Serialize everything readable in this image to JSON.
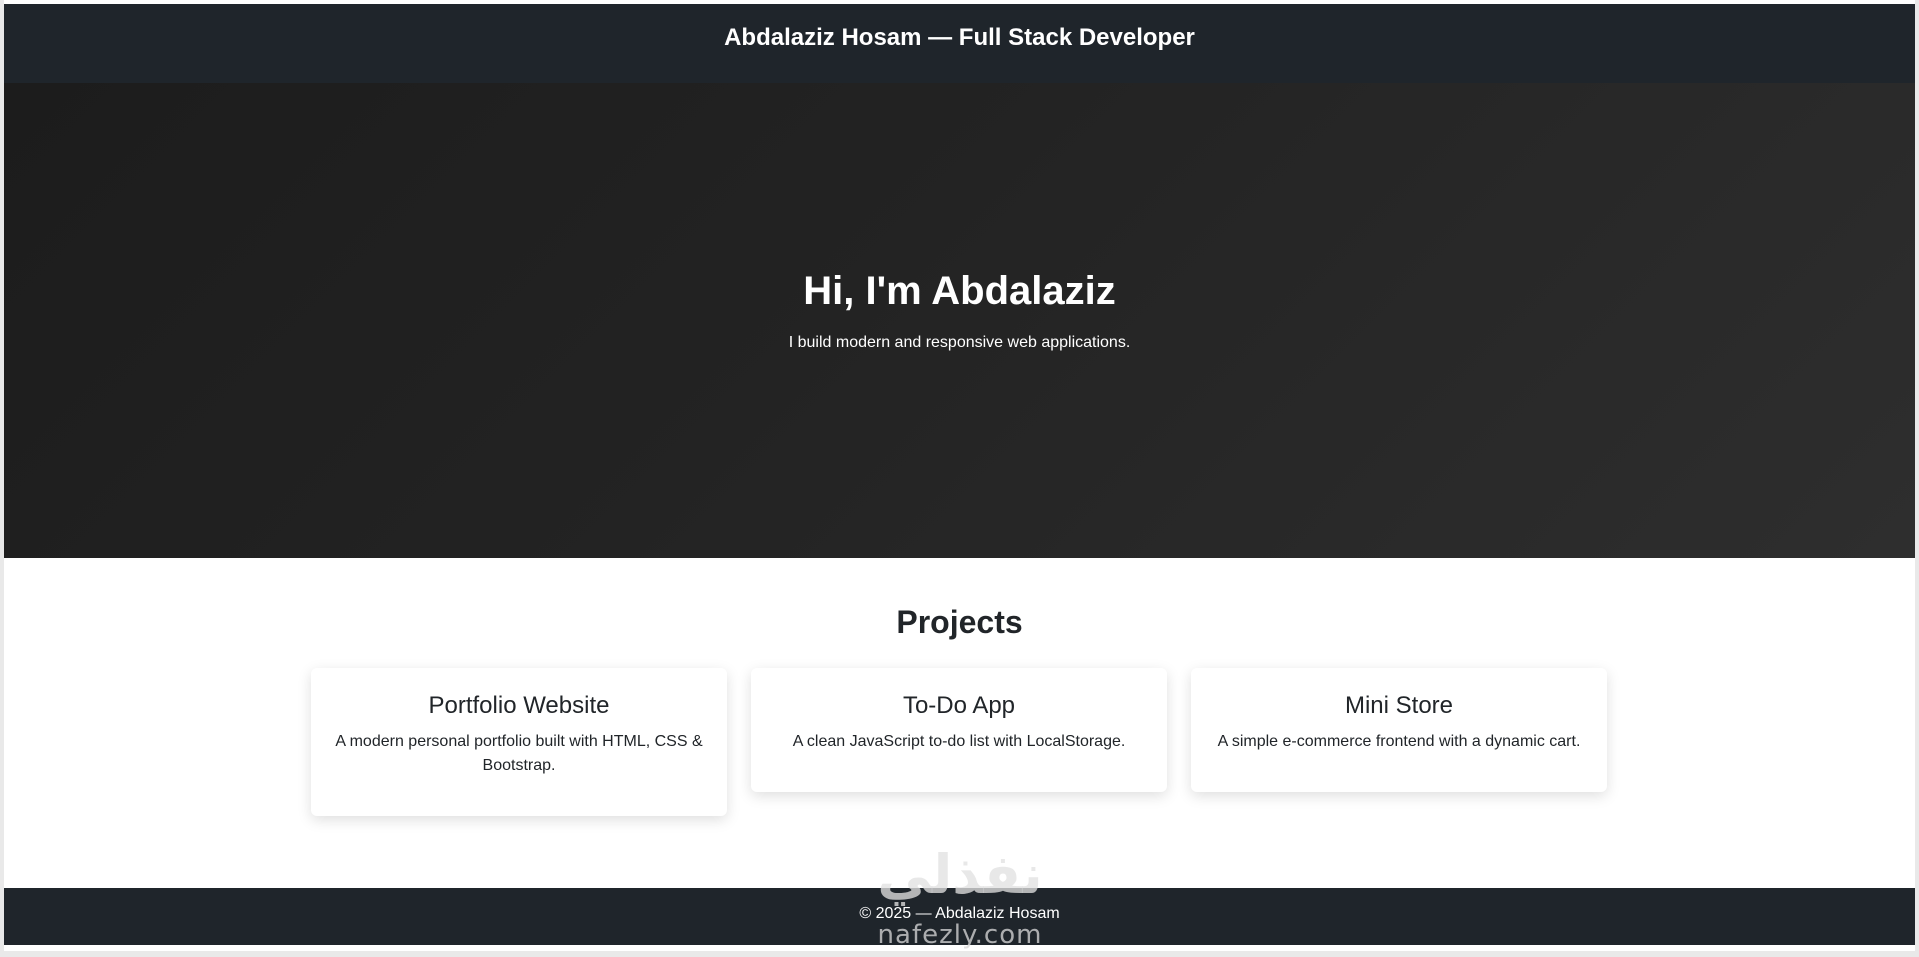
{
  "header": {
    "title": "Abdalaziz Hosam — Full Stack Developer"
  },
  "hero": {
    "title": "Hi, I'm Abdalaziz",
    "subtitle": "I build modern and responsive web applications."
  },
  "projects": {
    "title": "Projects",
    "items": [
      {
        "title": "Portfolio Website",
        "description": "A modern personal portfolio built with HTML, CSS & Bootstrap."
      },
      {
        "title": "To-Do App",
        "description": "A clean JavaScript to-do list with LocalStorage."
      },
      {
        "title": "Mini Store",
        "description": "A simple e-commerce frontend with a dynamic cart."
      }
    ]
  },
  "footer": {
    "text": "© 2025 — Abdalaziz Hosam"
  },
  "watermark": {
    "logo_text": "نفذلي",
    "domain": "nafezly.com"
  },
  "colors": {
    "header_bg": "#1f252b",
    "hero_bg_dark": "#1c1c1c",
    "hero_bg_light": "#2e2e2e",
    "footer_bg": "#1f252b",
    "text_dark": "#212529",
    "text_light": "#ffffff"
  }
}
